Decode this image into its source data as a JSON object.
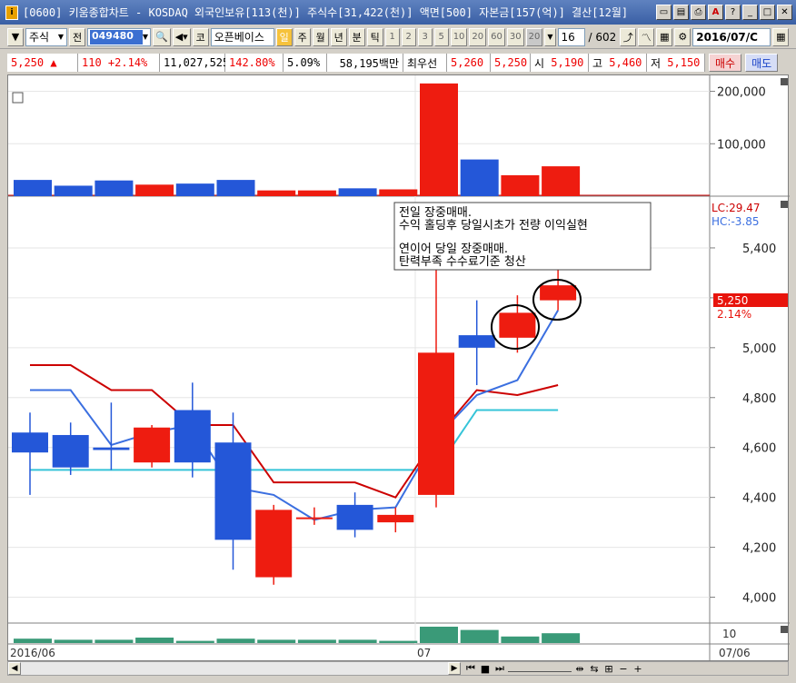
{
  "window": {
    "title": "[0600] 키움종합차트 - KOSDAQ 외국인보유[113(천)] 주식수[31,422(천)] 액면[500] 자본금[157(억)] 결산[12월]",
    "app_icon": "kiwoom-app-icon"
  },
  "toolbar": {
    "market_type": "주식",
    "jeon_label": "전",
    "stock_code": "049480",
    "ko_label": "코",
    "stock_name": "오픈베이스",
    "periods": [
      "일",
      "주",
      "월",
      "년",
      "분",
      "틱"
    ],
    "selected_period": "일",
    "intervals": [
      "1",
      "2",
      "3",
      "5",
      "10",
      "20",
      "60",
      "30",
      "20"
    ],
    "count_value": "16",
    "count_total": "/ 602",
    "date_value": "2016/07/C"
  },
  "quote": {
    "price": "5,250",
    "change_arrow": "▲",
    "change": "110",
    "change_pct": "+2.14%",
    "volume": "11,027,525",
    "volume_ratio": "142.80%",
    "turnover": "5.09%",
    "amount": "58,195백만",
    "best_bid_label": "최우선",
    "best_bid": "5,260",
    "best_ask": "5,250",
    "open_label": "시",
    "open": "5,190",
    "high_label": "고",
    "high": "5,460",
    "low_label": "저",
    "low": "5,150",
    "buy_label": "매수",
    "sell_label": "매도"
  },
  "annotation": {
    "line1": "전일 장중매매.",
    "line2": "수익 홀딩후 당일시초가 전량 이익실현",
    "line3": "연이어 당일 장중매매.",
    "line4": "탄력부족 수수료기준 청산"
  },
  "overlay_labels": {
    "lc": "LC:29.47",
    "hc": "HC:-3.85",
    "price_tag": "5,250",
    "pct_tag": "2.14%"
  },
  "x_labels": {
    "left": "2016/06",
    "mid": "07",
    "right": "07/06"
  },
  "bottom_indicator_label": "10",
  "colors": {
    "up": "#ee1c10",
    "down": "#2457d8",
    "lc_line": "#cc0000",
    "hc_line": "#3b6fe0",
    "baseline": "#35c4d8",
    "volume_sub": "#3a9a78"
  },
  "chart_data": {
    "type": "candlestick",
    "volume_axis": {
      "ticks": [
        "100,000",
        "200,000"
      ],
      "ylim": [
        0,
        220000
      ]
    },
    "price_axis": {
      "ticks": [
        "4,000",
        "4,200",
        "4,400",
        "4,600",
        "4,800",
        "5,000",
        "5,200",
        "5,400"
      ],
      "ylim": [
        3900,
        5600
      ]
    },
    "candles": [
      {
        "o": 4660,
        "h": 4740,
        "l": 4410,
        "c": 4580,
        "vol": 31000
      },
      {
        "o": 4650,
        "h": 4700,
        "l": 4490,
        "c": 4520,
        "vol": 20000
      },
      {
        "o": 4600,
        "h": 4780,
        "l": 4510,
        "c": 4590,
        "vol": 30000
      },
      {
        "o": 4540,
        "h": 4690,
        "l": 4520,
        "c": 4680,
        "vol": 22000
      },
      {
        "o": 4750,
        "h": 4860,
        "l": 4480,
        "c": 4540,
        "vol": 24000
      },
      {
        "o": 4620,
        "h": 4740,
        "l": 4110,
        "c": 4230,
        "vol": 31000
      },
      {
        "o": 4080,
        "h": 4370,
        "l": 4050,
        "c": 4350,
        "vol": 11000
      },
      {
        "o": 4320,
        "h": 4360,
        "l": 4290,
        "c": 4320,
        "vol": 11000
      },
      {
        "o": 4370,
        "h": 4420,
        "l": 4240,
        "c": 4270,
        "vol": 15000
      },
      {
        "o": 4300,
        "h": 4360,
        "l": 4260,
        "c": 4330,
        "vol": 13000
      },
      {
        "o": 4410,
        "h": 5380,
        "l": 4360,
        "c": 4980,
        "vol": 215000
      },
      {
        "o": 5050,
        "h": 5190,
        "l": 4850,
        "c": 5000,
        "vol": 70000
      },
      {
        "o": 5040,
        "h": 5210,
        "l": 4980,
        "c": 5140,
        "vol": 40000
      },
      {
        "o": 5190,
        "h": 5460,
        "l": 5150,
        "c": 5250,
        "vol": 57000
      }
    ],
    "lc_line": [
      4930,
      4930,
      4830,
      4830,
      4690,
      4690,
      4460,
      4460,
      4460,
      4400,
      4640,
      4830,
      4810,
      4850
    ],
    "hc_line": [
      4830,
      4830,
      4610,
      4660,
      4690,
      4440,
      4410,
      4310,
      4350,
      4360,
      4640,
      4810,
      4870,
      5150
    ],
    "base_line": [
      4510,
      4510,
      4510,
      4510,
      4510,
      4510,
      4510,
      4510,
      4510,
      4510,
      4510,
      4750,
      4750,
      4750
    ],
    "sub_volume": [
      4,
      3,
      3,
      5,
      2,
      4,
      3,
      3,
      3,
      2,
      15,
      12,
      6,
      9
    ]
  }
}
